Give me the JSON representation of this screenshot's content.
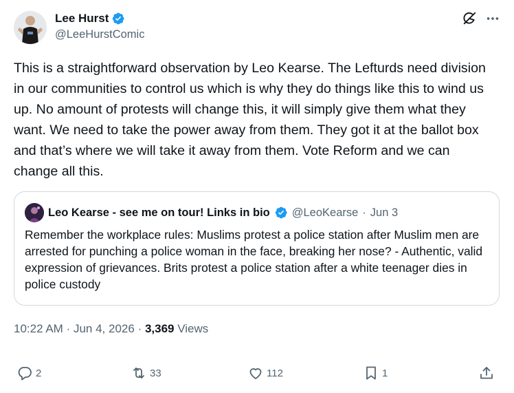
{
  "author": {
    "name": "Lee Hurst",
    "handle": "@LeeHurstComic",
    "verified_color": "#1d9bf0"
  },
  "tweet": {
    "text": "This is a straightforward observation by Leo Kearse. The Lefturds need division in our communities to control us which is why they do things like this to wind us up. No amount of protests will change this, it will simply give them what they want. We need to take the power away from them. They got it at the ballot box and that’s where we will take it away from them. Vote Reform and we can change all this."
  },
  "quote": {
    "name": "Leo Kearse - see me on tour! Links in bio",
    "handle": "@LeoKearse",
    "separator": "·",
    "date": "Jun 3",
    "text": "Remember the workplace rules:  Muslims protest a police station after Muslim men are arrested for punching a police woman in the face, breaking her nose? - Authentic, valid expression of grievances.  Brits protest a police station after a white teenager dies in police custody"
  },
  "meta": {
    "time": "10:22 AM",
    "separator": "·",
    "date": "Jun 4, 2026",
    "views_count": "3,369",
    "views_label": "Views"
  },
  "actions": {
    "replies": "2",
    "reposts": "33",
    "likes": "112",
    "bookmarks": "1"
  },
  "icons": {
    "verified": "verified-badge-icon",
    "grok": "grok-icon",
    "more": "more-icon",
    "reply": "reply-icon",
    "repost": "repost-icon",
    "like": "heart-icon",
    "bookmark": "bookmark-icon",
    "share": "share-icon"
  },
  "colors": {
    "text": "#0f1419",
    "secondary": "#536471",
    "border": "#cfd9de",
    "accent": "#1d9bf0"
  }
}
